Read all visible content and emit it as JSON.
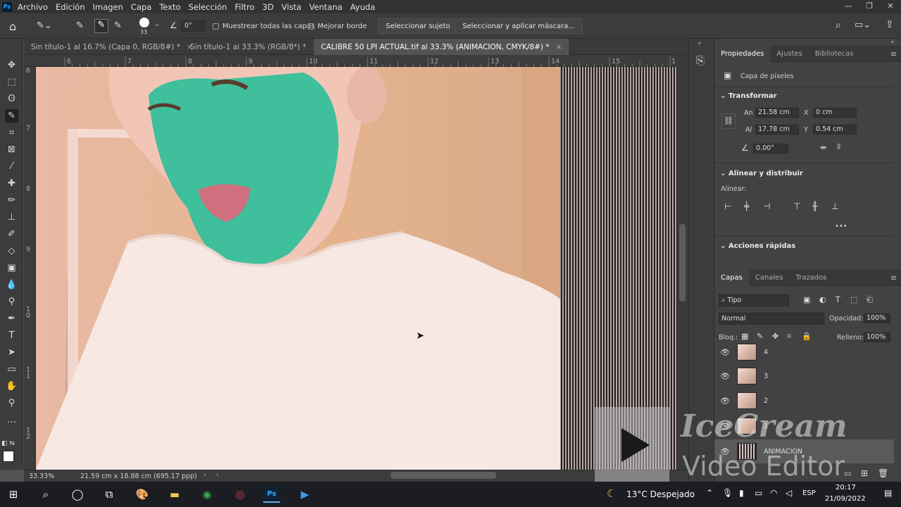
{
  "app": {
    "logo_text": "Ps"
  },
  "menu": [
    "Archivo",
    "Edición",
    "Imagen",
    "Capa",
    "Texto",
    "Selección",
    "Filtro",
    "3D",
    "Vista",
    "Ventana",
    "Ayuda"
  ],
  "options_bar": {
    "brush_size": "33",
    "angle": "0°",
    "sample_all_layers": "Muestrear todas las capas",
    "enhance_edge": "Mejorar borde",
    "select_subject": "Seleccionar sujeto",
    "select_and_mask": "Seleccionar y aplicar máscara..."
  },
  "tabs": [
    {
      "label": "Sin título-1 al 16.7% (Capa 0, RGB/8#) *",
      "active": false
    },
    {
      "label": "Sin título-1 al 33.3% (RGB/8*) *",
      "active": false
    },
    {
      "label": "CALIBRE 50 LPI ACTUAL.tif al 33.3% (ANIMACION, CMYK/8#) *",
      "active": true
    }
  ],
  "ruler": {
    "h_marks": [
      "6",
      "7",
      "8",
      "9",
      "10",
      "11",
      "12",
      "13",
      "14",
      "15",
      "1"
    ],
    "v_marks": [
      "6",
      "7",
      "8",
      "9",
      "10",
      "11",
      "12"
    ]
  },
  "status": {
    "zoom": "33.33%",
    "doc_info": "21.59 cm x 18.88 cm (695.17 ppp)"
  },
  "properties": {
    "tabs": [
      "Propiedades",
      "Ajustes",
      "Bibliotecas"
    ],
    "layer_kind": "Capa de píxeles",
    "transform_title": "Transformar",
    "an_label": "An",
    "an_value": "21.58 cm",
    "x_label": "X",
    "x_value": "0 cm",
    "al_label": "Al",
    "al_value": "17.78 cm",
    "y_label": "Y",
    "y_value": "0.54 cm",
    "angle_value": "0.00°",
    "align_title": "Alinear y distribuir",
    "align_label": "Alinear:",
    "quick_actions": "Acciones rápidas",
    "more": "•••"
  },
  "layers": {
    "tabs": [
      "Capas",
      "Canales",
      "Trazados"
    ],
    "filter": "Tipo",
    "blend": "Normal",
    "opacity_label": "Opacidad:",
    "opacity": "100%",
    "lock_label": "Bloq.:",
    "fill_label": "Relleno:",
    "fill": "100%",
    "items": [
      {
        "name": "4"
      },
      {
        "name": "3"
      },
      {
        "name": "2"
      },
      {
        "name": "1"
      },
      {
        "name": "ANIMACION"
      }
    ]
  },
  "watermark": {
    "line1": "IceCream",
    "line2": "Video Editor"
  },
  "taskbar": {
    "weather": "13°C  Despejado",
    "lang": "ESP",
    "time": "20:17",
    "date": "21/09/2022"
  },
  "colors": {
    "teal_mask": "#3fbf9c",
    "ps_blue": "#31a8ff"
  }
}
